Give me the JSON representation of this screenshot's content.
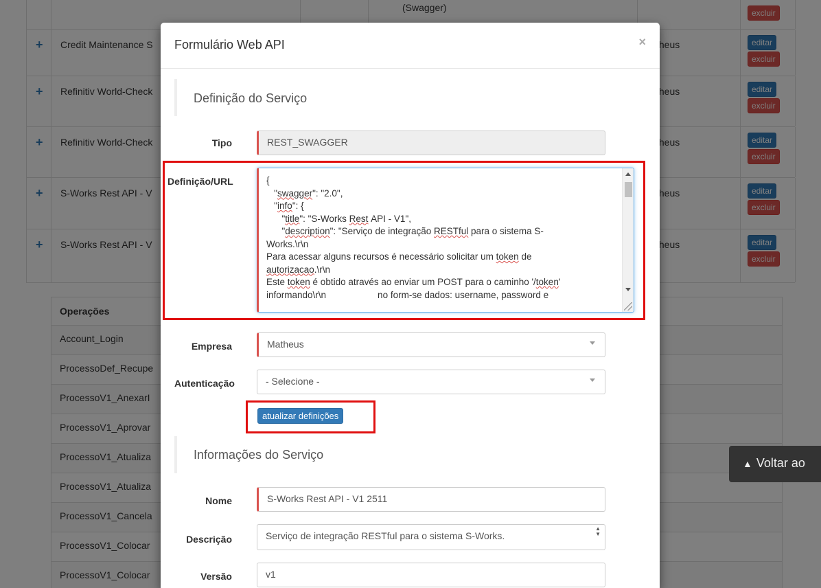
{
  "background": {
    "swagger_fragment": "(Swagger)",
    "rows": [
      {
        "name": "Credit Maintenance S",
        "responsible": "theus",
        "edit": "editar",
        "delete": "excluir"
      },
      {
        "name": "Refinitiv World-Check",
        "responsible": "theus",
        "edit": "editar",
        "delete": "excluir"
      },
      {
        "name": "Refinitiv World-Check",
        "responsible": "theus",
        "edit": "editar",
        "delete": "excluir"
      },
      {
        "name": "S-Works Rest API - V",
        "responsible": "theus",
        "edit": "editar",
        "delete": "excluir"
      },
      {
        "name": "S-Works Rest API - V",
        "responsible": "theus",
        "edit": "editar",
        "delete": "excluir"
      }
    ],
    "top_delete": "excluir",
    "operations": {
      "header": "Operações",
      "items": [
        "Account_Login",
        "ProcessoDef_Recupe",
        "ProcessoV1_AnexarI",
        "ProcessoV1_Aprovar",
        "ProcessoV1_Atualiza",
        "ProcessoV1_Atualiza",
        "ProcessoV1_Cancela",
        "ProcessoV1_Colocar",
        "ProcessoV1_Colocar"
      ]
    },
    "back_to_top": "Voltar ao"
  },
  "modal": {
    "title": "Formulário Web API",
    "close": "×",
    "section_definition": "Definição do Serviço",
    "tipo_label": "Tipo",
    "tipo_value": "REST_SWAGGER",
    "definicao_label": "Definição/URL",
    "definicao_lines": [
      "{",
      "   \"swagger\": \"2.0\",",
      "   \"info\": {",
      "      \"title\": \"S-Works Rest API - V1\",",
      "      \"description\": \"Serviço de integração RESTful para o sistema S-",
      "Works.\\r\\n",
      "Para acessar alguns recursos é necessário solicitar um token de",
      "autorizacao.\\r\\n",
      "Este token é obtido através ao enviar um POST para o caminho '/token'",
      "informando\\r\\n                    no form-se dados: username, password e"
    ],
    "empresa_label": "Empresa",
    "empresa_value": "Matheus",
    "autenticacao_label": "Autenticação",
    "autenticacao_value": "- Selecione -",
    "update_button": "atualizar definições",
    "section_info": "Informações do Serviço",
    "nome_label": "Nome",
    "nome_value": "S-Works Rest API - V1 2511",
    "descricao_label": "Descrição",
    "descricao_value": "Serviço de integração RESTful para o sistema S-Works.",
    "versao_label": "Versão",
    "versao_value": "v1"
  },
  "colors": {
    "primary": "#337ab7",
    "danger": "#d9534f",
    "highlight": "#e01010"
  }
}
